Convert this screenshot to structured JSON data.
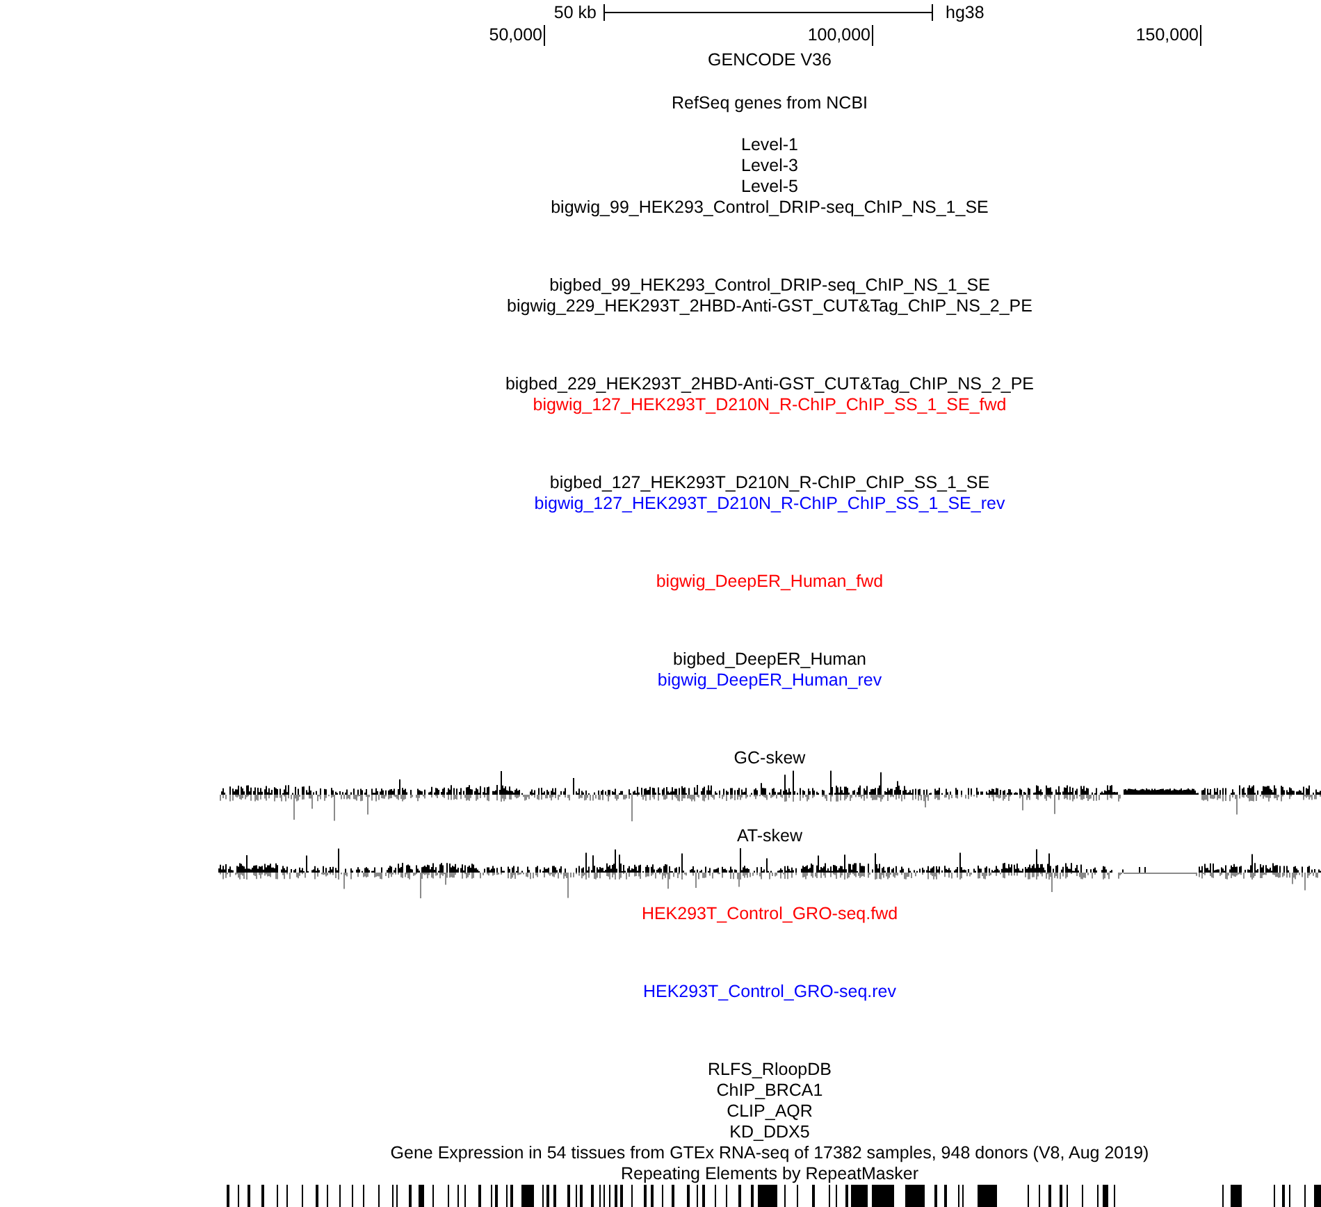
{
  "scale_bar": {
    "label": "50 kb",
    "assembly": "hg38"
  },
  "ruler": {
    "ticks": [
      "50,000",
      "100,000",
      "150,000"
    ]
  },
  "tracks": [
    {
      "label": "GENCODE V36",
      "kind": "gene",
      "color": "#000000"
    },
    {
      "label": "RefSeq genes from NCBI",
      "kind": "gene",
      "color": "#000000"
    },
    {
      "label": "Level-1",
      "kind": "dense",
      "color": "#000000"
    },
    {
      "label": "Level-3",
      "kind": "dense",
      "color": "#000000"
    },
    {
      "label": "Level-5",
      "kind": "dense",
      "color": "#000000"
    },
    {
      "label": "bigwig_99_HEK293_Control_DRIP-seq_ChIP_NS_1_SE",
      "kind": "wiggle",
      "color": "#000000"
    },
    {
      "label": "bigbed_99_HEK293_Control_DRIP-seq_ChIP_NS_1_SE",
      "kind": "dense",
      "color": "#000000"
    },
    {
      "label": "bigwig_229_HEK293T_2HBD-Anti-GST_CUT&Tag_ChIP_NS_2_PE",
      "kind": "wiggle",
      "color": "#000000"
    },
    {
      "label": "bigbed_229_HEK293T_2HBD-Anti-GST_CUT&Tag_ChIP_NS_2_PE",
      "kind": "dense",
      "color": "#000000"
    },
    {
      "label": "bigwig_127_HEK293T_D210N_R-ChIP_ChIP_SS_1_SE_fwd",
      "kind": "wiggle",
      "color": "#ff0000"
    },
    {
      "label": "bigbed_127_HEK293T_D210N_R-ChIP_ChIP_SS_1_SE",
      "kind": "dense",
      "color": "#000000"
    },
    {
      "label": "bigwig_127_HEK293T_D210N_R-ChIP_ChIP_SS_1_SE_rev",
      "kind": "wiggle",
      "color": "#0000ff"
    },
    {
      "label": "bigwig_DeepER_Human_fwd",
      "kind": "wiggle",
      "color": "#ff0000"
    },
    {
      "label": "bigbed_DeepER_Human",
      "kind": "dense",
      "color": "#000000"
    },
    {
      "label": "bigwig_DeepER_Human_rev",
      "kind": "wiggle",
      "color": "#0000ff"
    },
    {
      "label": "GC-skew",
      "kind": "skew",
      "color": "#000000"
    },
    {
      "label": "AT-skew",
      "kind": "skew",
      "color": "#000000"
    },
    {
      "label": "HEK293T_Control_GRO-seq.fwd",
      "kind": "wiggle",
      "color": "#ff0000"
    },
    {
      "label": "HEK293T_Control_GRO-seq.rev",
      "kind": "wiggle",
      "color": "#0000ff"
    },
    {
      "label": "RLFS_RloopDB",
      "kind": "dense",
      "color": "#000000"
    },
    {
      "label": "ChIP_BRCA1",
      "kind": "dense",
      "color": "#000000"
    },
    {
      "label": "CLIP_AQR",
      "kind": "dense",
      "color": "#000000"
    },
    {
      "label": "KD_DDX5",
      "kind": "dense",
      "color": "#000000"
    },
    {
      "label": "Gene Expression in 54 tissues from GTEx RNA-seq of 17382 samples, 948 donors (V8, Aug 2019)",
      "kind": "dense",
      "color": "#000000"
    },
    {
      "label": "Repeating Elements by RepeatMasker",
      "kind": "repeat",
      "color": "#000000"
    }
  ]
}
